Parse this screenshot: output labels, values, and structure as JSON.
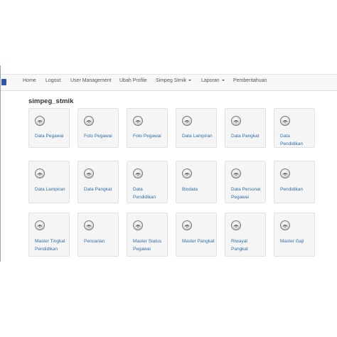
{
  "navbar": {
    "items": [
      {
        "label": "Home",
        "dropdown": false
      },
      {
        "label": "Logout",
        "dropdown": false
      },
      {
        "label": "User Management",
        "dropdown": false
      },
      {
        "label": "Ubah Profile",
        "dropdown": false
      },
      {
        "label": "Simpeg Stmik",
        "dropdown": true
      },
      {
        "label": "Laporan",
        "dropdown": true
      },
      {
        "label": "Pemberitahuan",
        "dropdown": false
      }
    ]
  },
  "page": {
    "title": "simpeg_stmik"
  },
  "tiles": [
    {
      "label": "Data Pegawai",
      "icon": "generic-app-icon"
    },
    {
      "label": "Foto Pegawai",
      "icon": "generic-app-icon"
    },
    {
      "label": "Foto Pegawai",
      "icon": "generic-app-icon"
    },
    {
      "label": "Data Lampiran",
      "icon": "generic-app-icon"
    },
    {
      "label": "Data Pangkat",
      "icon": "generic-app-icon"
    },
    {
      "label": "Data Pendidikan",
      "icon": "generic-app-icon"
    },
    {
      "label": "Data Lampiran",
      "icon": "generic-app-icon"
    },
    {
      "label": "Data Pangkat",
      "icon": "generic-app-icon"
    },
    {
      "label": "Data Pendidikan",
      "icon": "generic-app-icon"
    },
    {
      "label": "Biodata",
      "icon": "generic-app-icon"
    },
    {
      "label": "Data Personal Pegawai",
      "icon": "generic-app-icon"
    },
    {
      "label": "Pendidikan",
      "icon": "generic-app-icon"
    },
    {
      "label": "Master Tingkat Pendidikan",
      "icon": "generic-app-icon"
    },
    {
      "label": "Pencarian",
      "icon": "generic-app-icon"
    },
    {
      "label": "Master Status Pegawai",
      "icon": "generic-app-icon"
    },
    {
      "label": "Master Pangkat",
      "icon": "generic-app-icon"
    },
    {
      "label": "Riwayat Pangkat",
      "icon": "generic-app-icon"
    },
    {
      "label": "Master Gaji",
      "icon": "generic-app-icon"
    }
  ]
}
